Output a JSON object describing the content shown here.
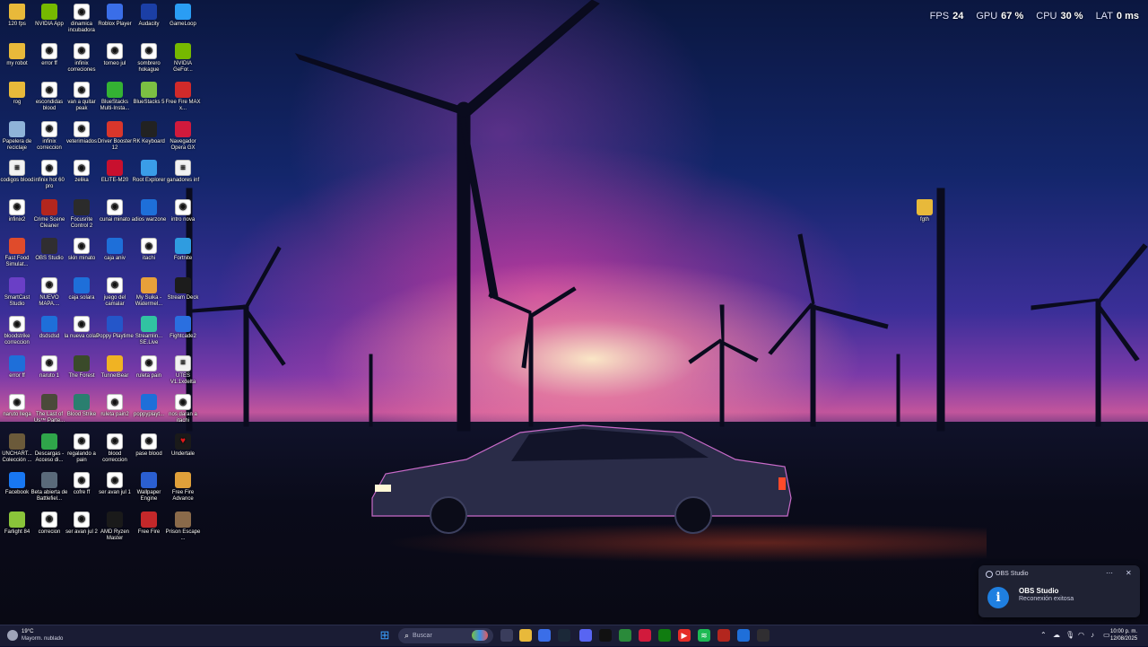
{
  "hud": {
    "fps_label": "FPS",
    "fps": "24",
    "gpu_label": "GPU",
    "gpu": "67 %",
    "cpu_label": "CPU",
    "cpu": "30 %",
    "lat_label": "LAT",
    "lat": "0 ms"
  },
  "desktop_icons": [
    {
      "label": "120 fps",
      "icon": "folder-icon",
      "color": "#e8b93a"
    },
    {
      "label": "NVIDIA App",
      "icon": "nvidia-icon",
      "color": "#76b900"
    },
    {
      "label": "dinamica incubadora",
      "icon": "file-icon",
      "color": "#ffffff"
    },
    {
      "label": "Roblox Player",
      "icon": "roblox-icon",
      "color": "#3a6ee8"
    },
    {
      "label": "Audacity",
      "icon": "audacity-icon",
      "color": "#1b3fa6"
    },
    {
      "label": "GameLoop",
      "icon": "gameloop-icon",
      "color": "#2a9df4"
    },
    {
      "label": "my robot",
      "icon": "folder-icon",
      "color": "#e8b93a"
    },
    {
      "label": "error ff",
      "icon": "file-icon",
      "color": "#ffffff"
    },
    {
      "label": "infinix correciones",
      "icon": "file-icon",
      "color": "#ffffff"
    },
    {
      "label": "torneo jul",
      "icon": "file-icon",
      "color": "#ffffff"
    },
    {
      "label": "sombrero hokague",
      "icon": "file-icon",
      "color": "#ffffff"
    },
    {
      "label": "NVIDIA GeFor...",
      "icon": "nvidia-icon",
      "color": "#76b900"
    },
    {
      "label": "rog",
      "icon": "folder-icon",
      "color": "#e8b93a"
    },
    {
      "label": "escondidas blood",
      "icon": "file-icon",
      "color": "#ffffff"
    },
    {
      "label": "van a quitar peak",
      "icon": "file-icon",
      "color": "#ffffff"
    },
    {
      "label": "BlueStacks Multi-Insta...",
      "icon": "bluestacks-icon",
      "color": "#34b233"
    },
    {
      "label": "BlueStacks 5",
      "icon": "bluestacks-icon",
      "color": "#7bc043"
    },
    {
      "label": "Free Fire MAX x...",
      "icon": "freefire-icon",
      "color": "#d12a2a"
    },
    {
      "label": "Papelera de reciclaje",
      "icon": "recycle-bin-icon",
      "color": "#8fb3d9"
    },
    {
      "label": "infinix correccion",
      "icon": "file-icon",
      "color": "#ffffff"
    },
    {
      "label": "veterimiados",
      "icon": "file-icon",
      "color": "#ffffff"
    },
    {
      "label": "Driver Booster 12",
      "icon": "driver-booster-icon",
      "color": "#d9362b"
    },
    {
      "label": "RK Keyboard",
      "icon": "keyboard-icon",
      "color": "#222222"
    },
    {
      "label": "Navegador Opera GX",
      "icon": "opera-gx-icon",
      "color": "#d11a3c"
    },
    {
      "label": "codigos blood",
      "icon": "document-icon",
      "color": "#f2f2f2"
    },
    {
      "label": "infinix hot 60 pro",
      "icon": "file-icon",
      "color": "#ffffff"
    },
    {
      "label": "zelika",
      "icon": "file-icon",
      "color": "#ffffff"
    },
    {
      "label": "ELITE-M20",
      "icon": "elite-icon",
      "color": "#c8102e"
    },
    {
      "label": "Root Explorer",
      "icon": "root-explorer-icon",
      "color": "#3a9de8"
    },
    {
      "label": "ganadores inf",
      "icon": "document-icon",
      "color": "#f2f2f2"
    },
    {
      "label": "infinix2",
      "icon": "file-icon",
      "color": "#ffffff"
    },
    {
      "label": "Crime Scene Cleaner",
      "icon": "game-icon",
      "color": "#b3261e"
    },
    {
      "label": "Focusrite Control 2",
      "icon": "focusrite-icon",
      "color": "#2b2b2b"
    },
    {
      "label": "cunai minato",
      "icon": "file-icon",
      "color": "#ffffff"
    },
    {
      "label": "adios warzone",
      "icon": "roblox-studio-icon",
      "color": "#1e6fd9"
    },
    {
      "label": "intro nova",
      "icon": "file-icon",
      "color": "#ffffff"
    },
    {
      "label": "Fast Food Simulat...",
      "icon": "game-icon",
      "color": "#e04b2b"
    },
    {
      "label": "OBS Studio",
      "icon": "obs-icon",
      "color": "#302e31"
    },
    {
      "label": "skin minato",
      "icon": "file-icon",
      "color": "#ffffff"
    },
    {
      "label": "caja aniv",
      "icon": "roblox-studio-icon",
      "color": "#1e6fd9"
    },
    {
      "label": "itachi",
      "icon": "file-icon",
      "color": "#ffffff"
    },
    {
      "label": "Fortnite",
      "icon": "fortnite-icon",
      "color": "#2f9ce0"
    },
    {
      "label": "SmartCast Studio",
      "icon": "smartcast-icon",
      "color": "#6a3fc6"
    },
    {
      "label": "NUEVO MAPA....",
      "icon": "file-icon",
      "color": "#ffffff"
    },
    {
      "label": "caja solara",
      "icon": "roblox-studio-icon",
      "color": "#1e6fd9"
    },
    {
      "label": "juego del camalar",
      "icon": "file-icon",
      "color": "#ffffff"
    },
    {
      "label": "My Suika - Watermel...",
      "icon": "game-icon",
      "color": "#e8a03a"
    },
    {
      "label": "Stream Deck",
      "icon": "stream-deck-icon",
      "color": "#1c1c1c"
    },
    {
      "label": "bloodstrike correccion",
      "icon": "file-icon",
      "color": "#ffffff"
    },
    {
      "label": "dsdsdsd",
      "icon": "roblox-studio-icon",
      "color": "#1e6fd9"
    },
    {
      "label": "la nueva colab",
      "icon": "file-icon",
      "color": "#ffffff"
    },
    {
      "label": "Poppy Playtime",
      "icon": "game-icon",
      "color": "#2456c9"
    },
    {
      "label": "Streamlin... SE.Live",
      "icon": "streamlabs-icon",
      "color": "#31c3a2"
    },
    {
      "label": "Fightcade2",
      "icon": "fightcade-icon",
      "color": "#2a6fe0"
    },
    {
      "label": "error ff",
      "icon": "roblox-studio-icon",
      "color": "#1e6fd9"
    },
    {
      "label": "naruto 1",
      "icon": "file-icon",
      "color": "#ffffff"
    },
    {
      "label": "The Forest",
      "icon": "game-icon",
      "color": "#3a4a2a"
    },
    {
      "label": "TunnelBear",
      "icon": "tunnelbear-icon",
      "color": "#f0b323"
    },
    {
      "label": "ruleta pain",
      "icon": "file-icon",
      "color": "#ffffff"
    },
    {
      "label": "UTES V1.1xdelta",
      "icon": "document-icon",
      "color": "#f2f2f2"
    },
    {
      "label": "naruto llega",
      "icon": "file-icon",
      "color": "#ffffff"
    },
    {
      "label": "The Last of Us™ Parte...",
      "icon": "game-icon",
      "color": "#4a4a3a"
    },
    {
      "label": "Blood Strike",
      "icon": "game-icon",
      "color": "#2a7f6f"
    },
    {
      "label": "ruleta pain2",
      "icon": "file-icon",
      "color": "#ffffff"
    },
    {
      "label": "poppyplayt...",
      "icon": "roblox-studio-icon",
      "color": "#1e6fd9"
    },
    {
      "label": "nos daran a itachi",
      "icon": "file-icon",
      "color": "#ffffff"
    },
    {
      "label": "UNCHART... Colección ...",
      "icon": "game-icon",
      "color": "#6b5a3a"
    },
    {
      "label": "Descargas - Acceso di...",
      "icon": "downloads-icon",
      "color": "#2fa54a"
    },
    {
      "label": "regalando a pain",
      "icon": "file-icon",
      "color": "#ffffff"
    },
    {
      "label": "blood correccion",
      "icon": "file-icon",
      "color": "#ffffff"
    },
    {
      "label": "pase blood",
      "icon": "file-icon",
      "color": "#ffffff"
    },
    {
      "label": "Undertale",
      "icon": "heart-icon",
      "color": "#1a1a1a"
    },
    {
      "label": "Facebook",
      "icon": "facebook-icon",
      "color": "#1877f2"
    },
    {
      "label": "Beta abierta de Battlefiel...",
      "icon": "game-icon",
      "color": "#5a6a7a"
    },
    {
      "label": "cofre ff",
      "icon": "file-icon",
      "color": "#ffffff"
    },
    {
      "label": "ser avan jul 1",
      "icon": "file-icon",
      "color": "#ffffff"
    },
    {
      "label": "Wallpaper Engine",
      "icon": "wallpaper-engine-icon",
      "color": "#2b5fd1"
    },
    {
      "label": "Free Fire Advance",
      "icon": "game-icon",
      "color": "#e0a03a"
    },
    {
      "label": "Farlight 84",
      "icon": "game-icon",
      "color": "#8ac43a"
    },
    {
      "label": "correcion",
      "icon": "file-icon",
      "color": "#ffffff"
    },
    {
      "label": "ser avan jul 2",
      "icon": "file-icon",
      "color": "#ffffff"
    },
    {
      "label": "AMD Ryzen Master",
      "icon": "amd-icon",
      "color": "#1a1a1a"
    },
    {
      "label": "Free Fire",
      "icon": "freefire-icon",
      "color": "#c4282a"
    },
    {
      "label": "Prison Escape ...",
      "icon": "game-icon",
      "color": "#8a6a4a"
    },
    {
      "label": "fgth",
      "icon": "folder-icon",
      "color": "#e8b93a"
    }
  ],
  "toast": {
    "app": "OBS Studio",
    "title": "OBS Studio",
    "message": "Reconexión exitosa",
    "more_icon": "more-icon",
    "close_icon": "close-icon"
  },
  "taskbar": {
    "weather": {
      "temp": "19°C",
      "condition": "Mayorm. nublado",
      "icon": "cloud-icon"
    },
    "search": {
      "placeholder": "Buscar"
    },
    "apps": [
      {
        "name": "start-button",
        "icon": "windows-icon",
        "color": "#3aa0ff"
      },
      {
        "name": "task-view-button",
        "icon": "task-view-icon",
        "color": "#3a3d5c"
      },
      {
        "name": "file-explorer-button",
        "icon": "folder-icon",
        "color": "#e8b93a"
      },
      {
        "name": "store-button",
        "icon": "store-icon",
        "color": "#3a6ee8"
      },
      {
        "name": "steam-button",
        "icon": "steam-icon",
        "color": "#1b2838"
      },
      {
        "name": "discord-button",
        "icon": "discord-icon",
        "color": "#5865f2"
      },
      {
        "name": "tiktok-button",
        "icon": "tiktok-icon",
        "color": "#111111"
      },
      {
        "name": "chrome-button",
        "icon": "chrome-icon",
        "color": "#2a8a3a"
      },
      {
        "name": "opera-gx-button",
        "icon": "opera-gx-icon",
        "color": "#d11a3c"
      },
      {
        "name": "xbox-button",
        "icon": "xbox-icon",
        "color": "#107c10"
      },
      {
        "name": "youtube-button",
        "icon": "youtube-icon",
        "color": "#e52d27"
      },
      {
        "name": "spotify-button",
        "icon": "spotify-icon",
        "color": "#1db954"
      },
      {
        "name": "media-button",
        "icon": "media-icon",
        "color": "#b3261e"
      },
      {
        "name": "taskbar-app-button",
        "icon": "app-icon",
        "color": "#1f6fd9"
      },
      {
        "name": "obs-button",
        "icon": "obs-icon",
        "color": "#302e31"
      }
    ],
    "tray": {
      "icons": [
        "chevron-up-icon",
        "cloud-sync-icon",
        "microphone-icon",
        "wifi-icon",
        "volume-icon",
        "battery-icon"
      ],
      "time": "10:00 p. m.",
      "date": "12/08/2025"
    }
  }
}
